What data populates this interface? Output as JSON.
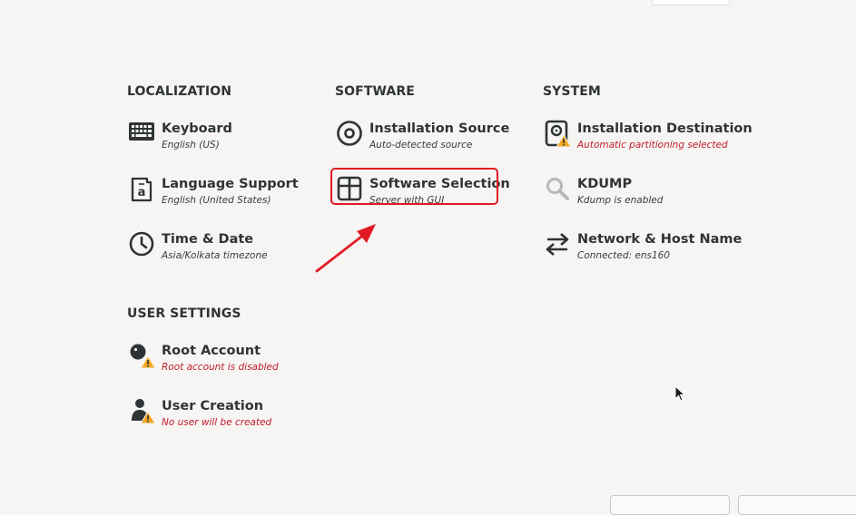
{
  "sections": {
    "localization": "LOCALIZATION",
    "software": "SOFTWARE",
    "system": "SYSTEM",
    "user_settings": "USER SETTINGS"
  },
  "spokes": {
    "keyboard": {
      "title": "Keyboard",
      "status": "English (US)",
      "icon": "keyboard-icon"
    },
    "language": {
      "title": "Language Support",
      "status": "English (United States)",
      "icon": "language-icon"
    },
    "time": {
      "title": "Time & Date",
      "status": "Asia/Kolkata timezone",
      "icon": "clock-icon"
    },
    "install_source": {
      "title": "Installation Source",
      "status": "Auto-detected source",
      "icon": "disc-icon"
    },
    "software_selection": {
      "title": "Software Selection",
      "status": "Server with GUI",
      "icon": "package-icon"
    },
    "install_dest": {
      "title": "Installation Destination",
      "status": "Automatic partitioning selected",
      "icon": "harddisk-warning-icon"
    },
    "kdump": {
      "title": "KDUMP",
      "status": "Kdump is enabled",
      "icon": "magnifier-icon"
    },
    "network": {
      "title": "Network & Host Name",
      "status": "Connected: ens160",
      "icon": "network-arrows-icon"
    },
    "root": {
      "title": "Root Account",
      "status": "Root account is disabled",
      "icon": "root-warning-icon"
    },
    "user": {
      "title": "User Creation",
      "status": "No user will be created",
      "icon": "user-warning-icon"
    }
  },
  "colors": {
    "background": "#f6f5f4",
    "text": "#2e3436",
    "warning_text": "#c01c28",
    "warning_badge": "#f5a623",
    "highlight": "#e01b24"
  }
}
